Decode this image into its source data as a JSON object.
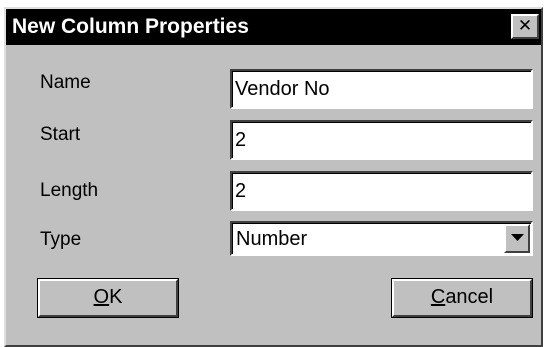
{
  "dialog": {
    "title": "New Column Properties",
    "close_glyph": "✕"
  },
  "fields": {
    "name": {
      "label": "Name",
      "value": "Vendor No"
    },
    "start": {
      "label": "Start",
      "value": "2"
    },
    "length": {
      "label": "Length",
      "value": "2"
    },
    "type": {
      "label": "Type",
      "value": "Number"
    }
  },
  "buttons": {
    "ok": {
      "mnemonic": "O",
      "rest": "K"
    },
    "cancel": {
      "mnemonic": "C",
      "rest": "ancel"
    }
  },
  "icons": {
    "close": "close-icon",
    "dropdown": "chevron-down-icon"
  },
  "colors": {
    "titlebar": "#000000",
    "face": "#c0c0c0",
    "field_bg": "#ffffff"
  }
}
